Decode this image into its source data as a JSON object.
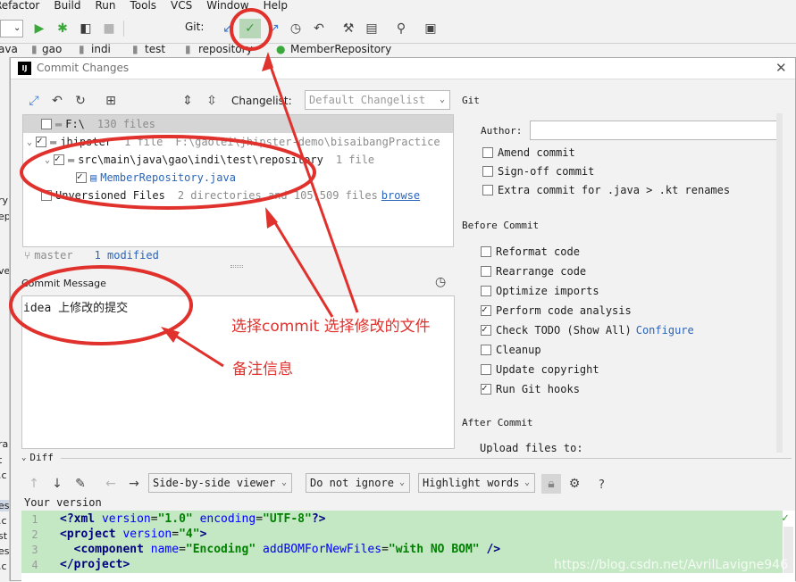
{
  "menu": [
    "Refactor",
    "Build",
    "Run",
    "Tools",
    "VCS",
    "Window",
    "Help"
  ],
  "toolbar": {
    "git_label": "Git:"
  },
  "breadcrumb": [
    "ava",
    "gao",
    "indi",
    "test",
    "repository",
    "MemberRepository"
  ],
  "left_fragments": [
    "ry",
    "ep",
    "ve",
    "ra",
    "t",
    ".c",
    "es",
    ".c",
    "st",
    "es",
    ".c"
  ],
  "dialog": {
    "title": "Commit Changes",
    "changelist_label": "Changelist:",
    "changelist_value": "Default Changelist",
    "tree": {
      "root_label": "F:\\",
      "root_count": "130 files",
      "module_label": "jhipster",
      "module_count": "1 file",
      "module_path": "F:\\gaolei\\jhipster-demo\\bisaibangPractice",
      "dir_label": "src\\main\\java\\gao\\indi\\test\\repository",
      "dir_count": "1 file",
      "file_label": "MemberRepository.java",
      "unversioned_label": "Unversioned Files",
      "unversioned_count": "2 directories and 105,509 files",
      "browse_link": "browse"
    },
    "status": {
      "branch": "master",
      "modified": "1 modified"
    },
    "commit_message_label": "Commit Message",
    "commit_message": "idea 上修改的提交",
    "git_section": {
      "title": "Git",
      "author_label": "Author:",
      "author_value": "",
      "options": [
        {
          "label": "Amend commit",
          "checked": false
        },
        {
          "label": "Sign-off commit",
          "checked": false
        },
        {
          "label": "Extra commit for .java > .kt renames",
          "checked": false
        }
      ]
    },
    "before_commit": {
      "title": "Before Commit",
      "options": [
        {
          "label": "Reformat code",
          "checked": false
        },
        {
          "label": "Rearrange code",
          "checked": false
        },
        {
          "label": "Optimize imports",
          "checked": false
        },
        {
          "label": "Perform code analysis",
          "checked": true
        },
        {
          "label": "Check TODO (Show All)",
          "checked": true,
          "link": "Configure"
        },
        {
          "label": "Cleanup",
          "checked": false
        },
        {
          "label": "Update copyright",
          "checked": false
        },
        {
          "label": "Run Git hooks",
          "checked": true
        }
      ]
    },
    "after_commit": {
      "title": "After Commit",
      "upload_label": "Upload files to:"
    },
    "diff": {
      "title": "Diff",
      "viewer": "Side-by-side viewer",
      "ignore": "Do not ignore",
      "highlight": "Highlight words",
      "help": "?",
      "your_version": "Your version",
      "lines": [
        "1",
        "2",
        "3",
        "4"
      ]
    }
  },
  "annotations": {
    "select_text": "选择commit 选择修改的文件",
    "note_text": "备注信息"
  },
  "watermark": "https://blog.csdn.net/AvrilLavigne946",
  "colors": {
    "diff_bg": "#c3e8c3",
    "annotation": "#e0312c",
    "link": "#2a65b8"
  }
}
